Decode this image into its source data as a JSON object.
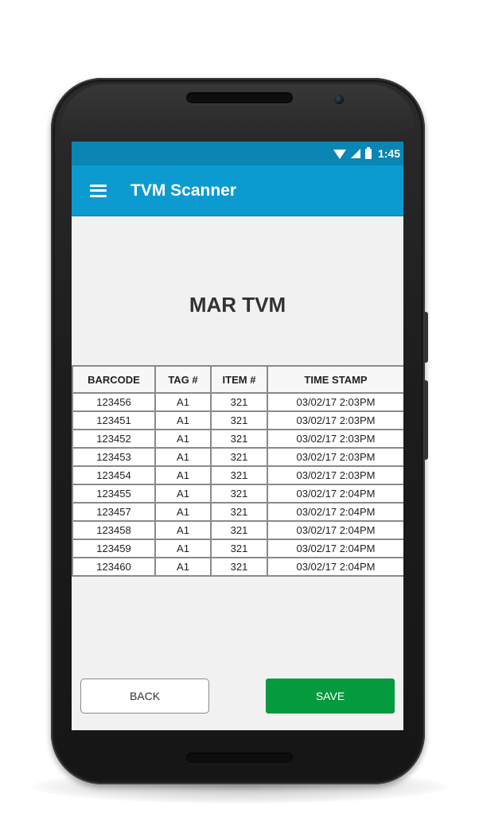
{
  "status_bar": {
    "time": "1:45",
    "icons": [
      "wifi-icon",
      "signal-icon",
      "battery-icon"
    ]
  },
  "app_bar": {
    "menu_icon": "menu-icon",
    "title": "TVM Scanner",
    "color": "#0b9bd1"
  },
  "page": {
    "heading": "MAR TVM"
  },
  "table": {
    "headers": [
      "BARCODE",
      "TAG #",
      "ITEM #",
      "TIME STAMP"
    ],
    "rows": [
      [
        "123456",
        "A1",
        "321",
        "03/02/17 2:03PM"
      ],
      [
        "123451",
        "A1",
        "321",
        "03/02/17 2:03PM"
      ],
      [
        "123452",
        "A1",
        "321",
        "03/02/17 2:03PM"
      ],
      [
        "123453",
        "A1",
        "321",
        "03/02/17 2:03PM"
      ],
      [
        "123454",
        "A1",
        "321",
        "03/02/17 2:03PM"
      ],
      [
        "123455",
        "A1",
        "321",
        "03/02/17 2:04PM"
      ],
      [
        "123457",
        "A1",
        "321",
        "03/02/17 2:04PM"
      ],
      [
        "123458",
        "A1",
        "321",
        "03/02/17 2:04PM"
      ],
      [
        "123459",
        "A1",
        "321",
        "03/02/17 2:04PM"
      ],
      [
        "123460",
        "A1",
        "321",
        "03/02/17 2:04PM"
      ]
    ]
  },
  "buttons": {
    "back_label": "BACK",
    "save_label": "SAVE",
    "save_color": "#069a3f"
  }
}
